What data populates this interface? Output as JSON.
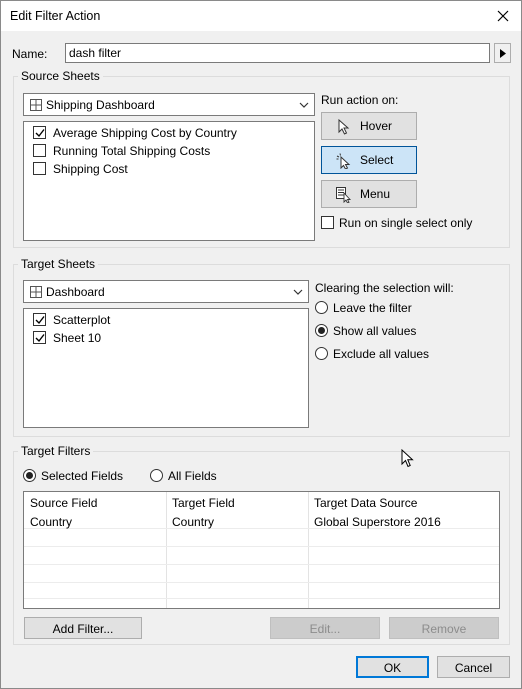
{
  "window": {
    "title": "Edit Filter Action"
  },
  "name": {
    "label": "Name:",
    "value": "dash filter"
  },
  "source_sheets": {
    "title": "Source Sheets",
    "dropdown": {
      "value": "Shipping Dashboard"
    },
    "items": [
      {
        "label": "Average Shipping Cost by Country",
        "checked": true
      },
      {
        "label": "Running Total Shipping Costs",
        "checked": false
      },
      {
        "label": "Shipping Cost",
        "checked": false
      }
    ],
    "run_action_on": "Run action on:",
    "actions": [
      {
        "label": "Hover",
        "icon": "pointer-icon",
        "selected": false
      },
      {
        "label": "Select",
        "icon": "select-pointer-icon",
        "selected": true
      },
      {
        "label": "Menu",
        "icon": "menu-icon",
        "selected": false
      }
    ],
    "single_select": {
      "label": "Run on single select only",
      "checked": false
    }
  },
  "target_sheets": {
    "title": "Target Sheets",
    "dropdown": {
      "value": "Dashboard"
    },
    "items": [
      {
        "label": "Scatterplot",
        "checked": true
      },
      {
        "label": "Sheet 10",
        "checked": true
      }
    ],
    "clearing_label": "Clearing the selection will:",
    "clearing_options": [
      {
        "label": "Leave the filter",
        "selected": false
      },
      {
        "label": "Show all values",
        "selected": true
      },
      {
        "label": "Exclude all values",
        "selected": false
      }
    ]
  },
  "target_filters": {
    "title": "Target Filters",
    "modes": [
      {
        "label": "Selected Fields",
        "selected": true
      },
      {
        "label": "All Fields",
        "selected": false
      }
    ],
    "columns": [
      "Source Field",
      "Target Field",
      "Target Data Source"
    ],
    "rows": [
      [
        "Country",
        "Country",
        "Global Superstore 2016"
      ]
    ],
    "buttons": {
      "add": "Add Filter...",
      "edit": "Edit...",
      "remove": "Remove"
    }
  },
  "footer": {
    "ok": "OK",
    "cancel": "Cancel"
  },
  "colors": {
    "accent": "#0078d7",
    "selected_bg": "#cce4f7",
    "border": "#7a7a7a"
  }
}
